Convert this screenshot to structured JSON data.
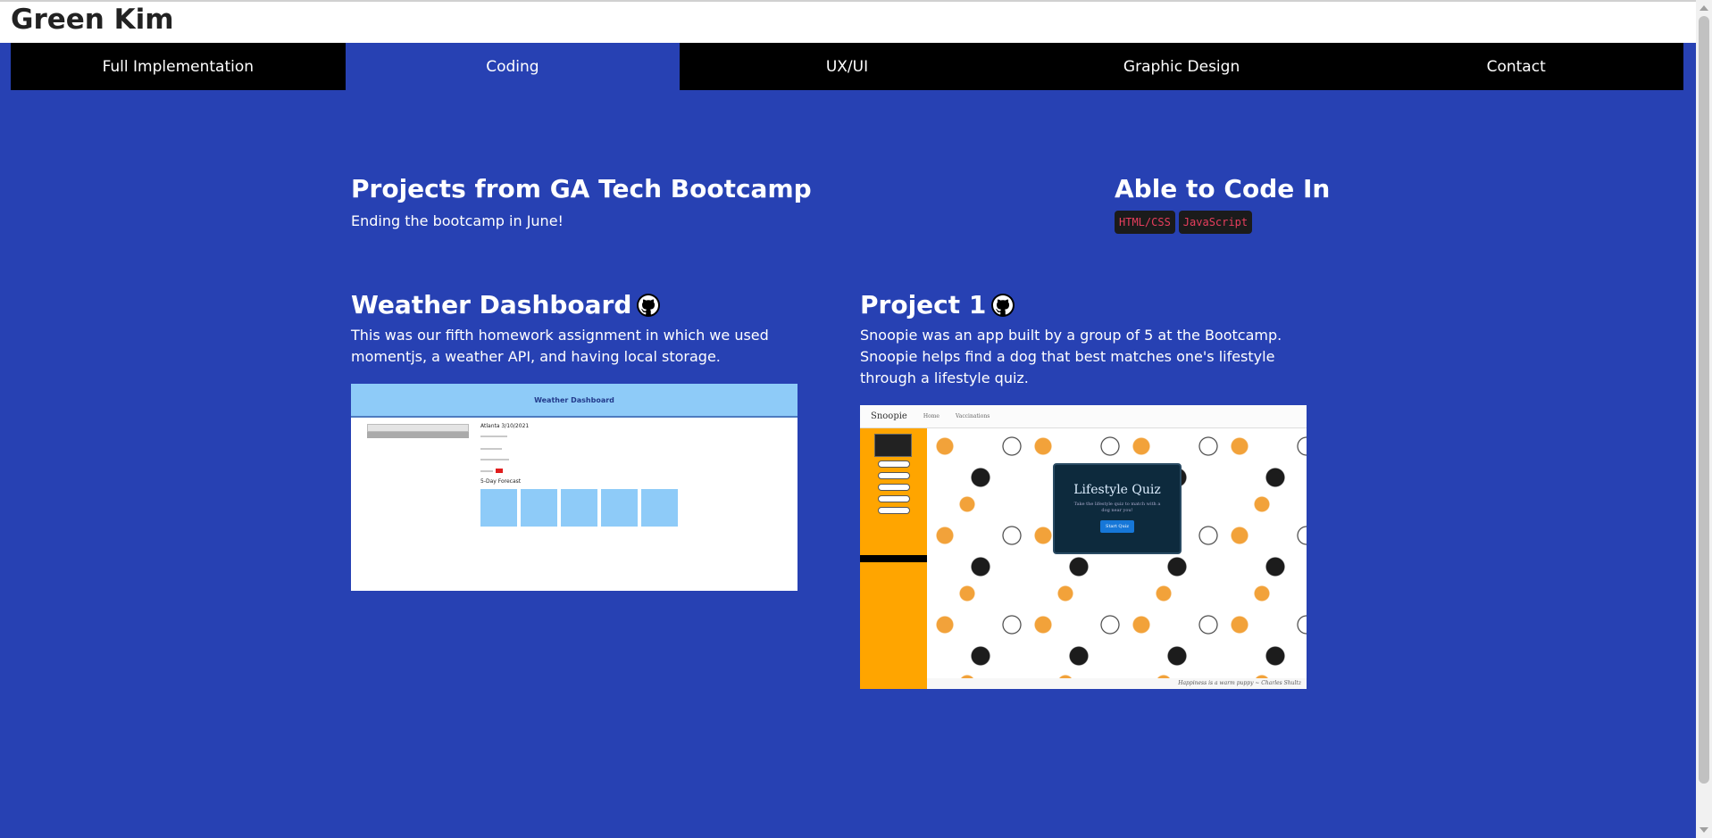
{
  "header": {
    "title": "Green Kim"
  },
  "nav": {
    "tabs": [
      {
        "label": "Full Implementation",
        "active": false
      },
      {
        "label": "Coding",
        "active": true
      },
      {
        "label": "UX/UI",
        "active": false
      },
      {
        "label": "Graphic Design",
        "active": false
      },
      {
        "label": "Contact",
        "active": false
      }
    ]
  },
  "bootcamp": {
    "title": "Projects from GA Tech Bootcamp",
    "subtitle": "Ending the bootcamp in June!"
  },
  "skills": {
    "title": "Able to Code In",
    "badges": [
      "HTML/CSS",
      "JavaScript"
    ]
  },
  "projects": [
    {
      "title": "Weather Dashboard",
      "description": "This was our fifth homework assignment in which we used momentjs, a weather API, and having local storage.",
      "preview": {
        "header": "Weather Dashboard",
        "city": "Atlanta  3/10/2021",
        "forecast_label": "5-Day Forecast"
      }
    },
    {
      "title": "Project 1",
      "description": "Snoopie was an app built by a group of 5 at the Bootcamp. Snoopie helps find a dog that best matches one's lifestyle through a lifestyle quiz.",
      "preview": {
        "brand": "Snoopie",
        "nav_links": [
          "Home",
          "Vaccinations"
        ],
        "quiz_title": "Lifestyle Quiz",
        "quiz_text": "Take the lifestyle quiz to match with a dog near you!",
        "quiz_button": "Start Quiz",
        "footer": "Happiness is a warm puppy ~ Charles Shultz"
      }
    }
  ],
  "colors": {
    "background": "#2741b3",
    "nav": "#000000",
    "badge_text": "#e83e5d"
  },
  "icons": {
    "project_link": "github-icon"
  }
}
